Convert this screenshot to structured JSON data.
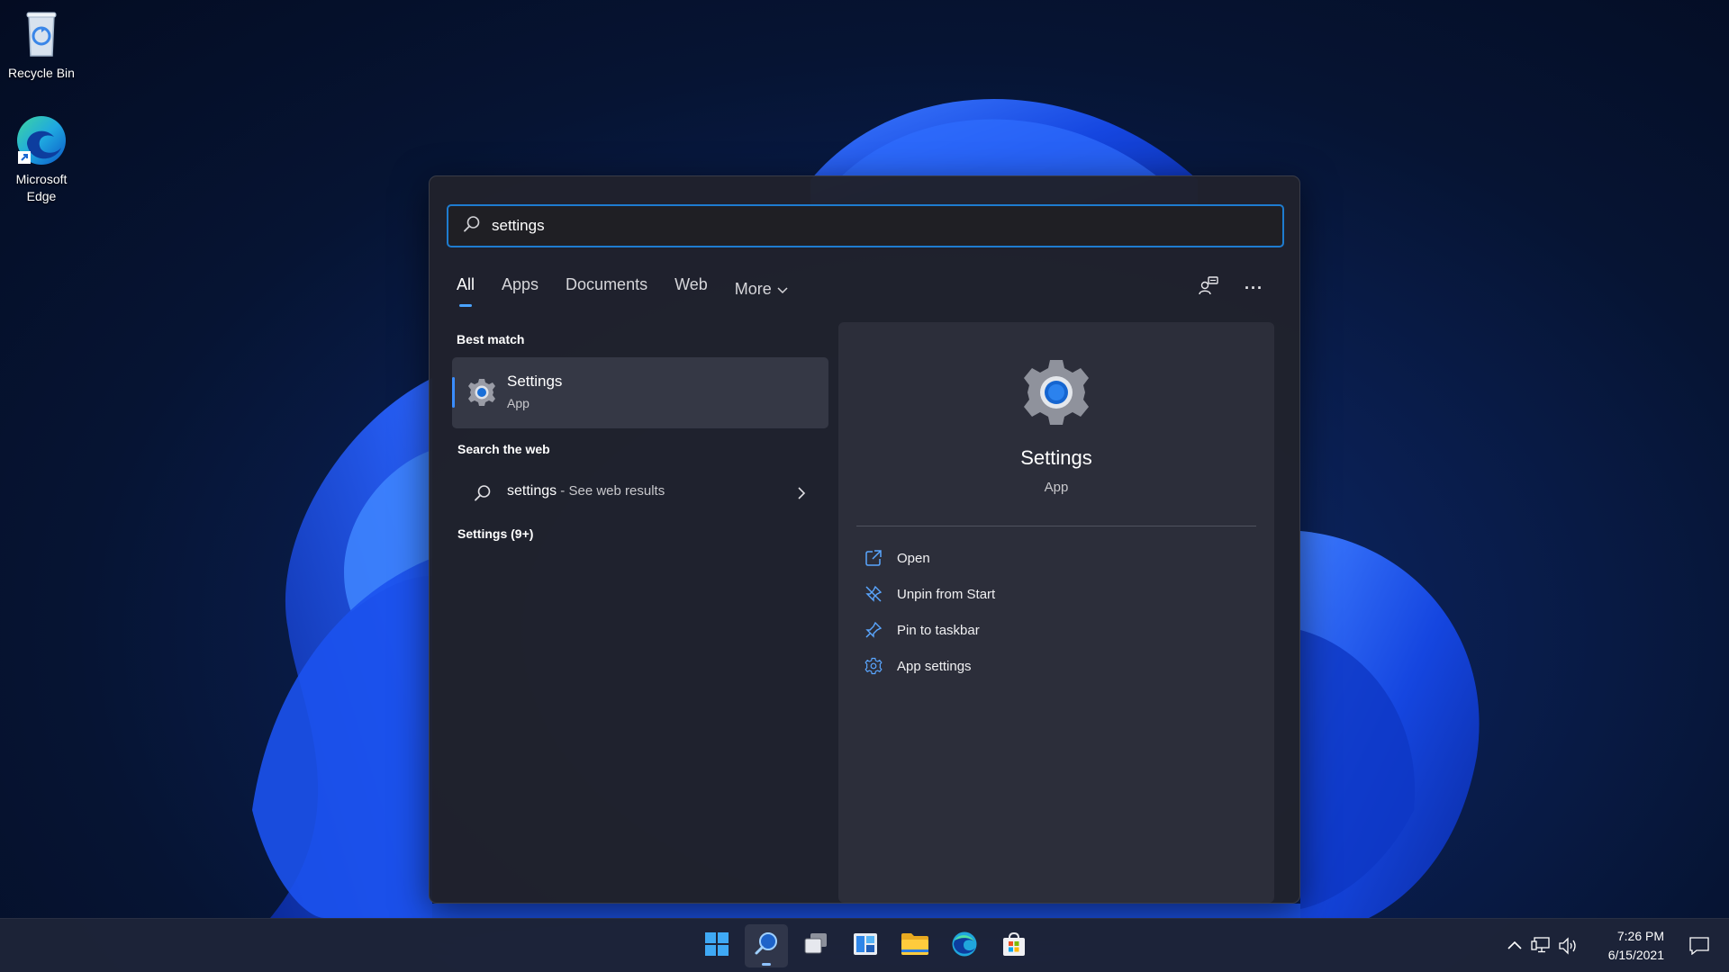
{
  "desktop": {
    "icons": [
      {
        "label": "Recycle Bin",
        "icon": "recycle-bin-icon"
      },
      {
        "label": "Microsoft Edge",
        "icon": "edge-icon"
      }
    ]
  },
  "search": {
    "query": "settings",
    "icon": "search-icon"
  },
  "tabs": [
    {
      "label": "All",
      "active": true
    },
    {
      "label": "Apps"
    },
    {
      "label": "Documents"
    },
    {
      "label": "Web"
    },
    {
      "label": "More",
      "icon": "chevron-down-icon"
    }
  ],
  "toolbar": {
    "share_icon": "account-share-icon",
    "more_icon": "ellipsis-icon",
    "more_label": "···"
  },
  "results": {
    "best_match_heading": "Best match",
    "best_match": {
      "title": "Settings",
      "subtitle": "App",
      "icon": "settings-gear-icon"
    },
    "web_heading": "Search the web",
    "web_item": {
      "query": "settings",
      "suffix": " - See web results",
      "icon": "search-icon"
    },
    "settings_heading": "Settings (9+)"
  },
  "preview": {
    "title": "Settings",
    "subtitle": "App",
    "actions": [
      {
        "label": "Open",
        "icon": "open-external-icon"
      },
      {
        "label": "Unpin from Start",
        "icon": "unpin-icon"
      },
      {
        "label": "Pin to taskbar",
        "icon": "pin-icon"
      },
      {
        "label": "App settings",
        "icon": "gear-icon"
      }
    ]
  },
  "taskbar": {
    "apps": [
      {
        "name": "start",
        "icon": "windows-logo-icon"
      },
      {
        "name": "search",
        "icon": "search-icon",
        "active": true
      },
      {
        "name": "task-view",
        "icon": "task-view-icon"
      },
      {
        "name": "widgets",
        "icon": "widgets-icon"
      },
      {
        "name": "file-explorer",
        "icon": "folder-icon"
      },
      {
        "name": "edge",
        "icon": "edge-icon"
      },
      {
        "name": "store",
        "icon": "store-icon"
      }
    ],
    "tray": {
      "icons": [
        "chevron-up-icon",
        "network-icon",
        "volume-icon"
      ],
      "time": "7:26 PM",
      "date": "6/15/2021",
      "notification_icon": "notification-icon"
    }
  },
  "colors": {
    "accent": "#3a8dff",
    "search_border": "#1e7cd0",
    "flyout_bg": "#20222c",
    "wallpaper_blue": "#1a4fe0"
  }
}
